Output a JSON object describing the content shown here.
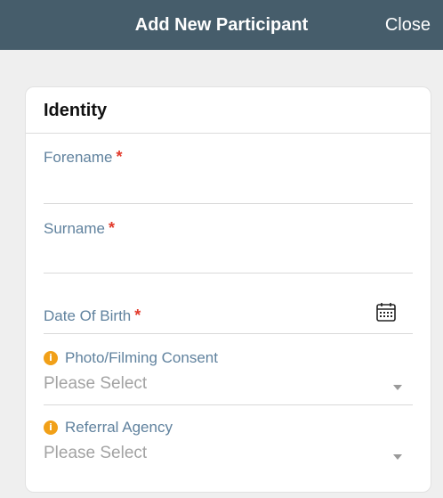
{
  "header": {
    "title": "Add New Participant",
    "close_label": "Close"
  },
  "section": {
    "title": "Identity"
  },
  "fields": {
    "forename": {
      "label": "Forename",
      "required_mark": "*"
    },
    "surname": {
      "label": "Surname",
      "required_mark": "*"
    },
    "dob": {
      "label": "Date Of Birth",
      "required_mark": "*",
      "icon": "calendar-icon"
    },
    "photo_consent": {
      "label": "Photo/Filming Consent",
      "value": "Please Select",
      "info_icon": "i"
    },
    "referral_agency": {
      "label": "Referral Agency",
      "value": "Please Select",
      "info_icon": "i"
    }
  },
  "colors": {
    "header_bg": "#465d6b",
    "label": "#60829e",
    "required": "#e23a2b",
    "info": "#f1a018"
  }
}
